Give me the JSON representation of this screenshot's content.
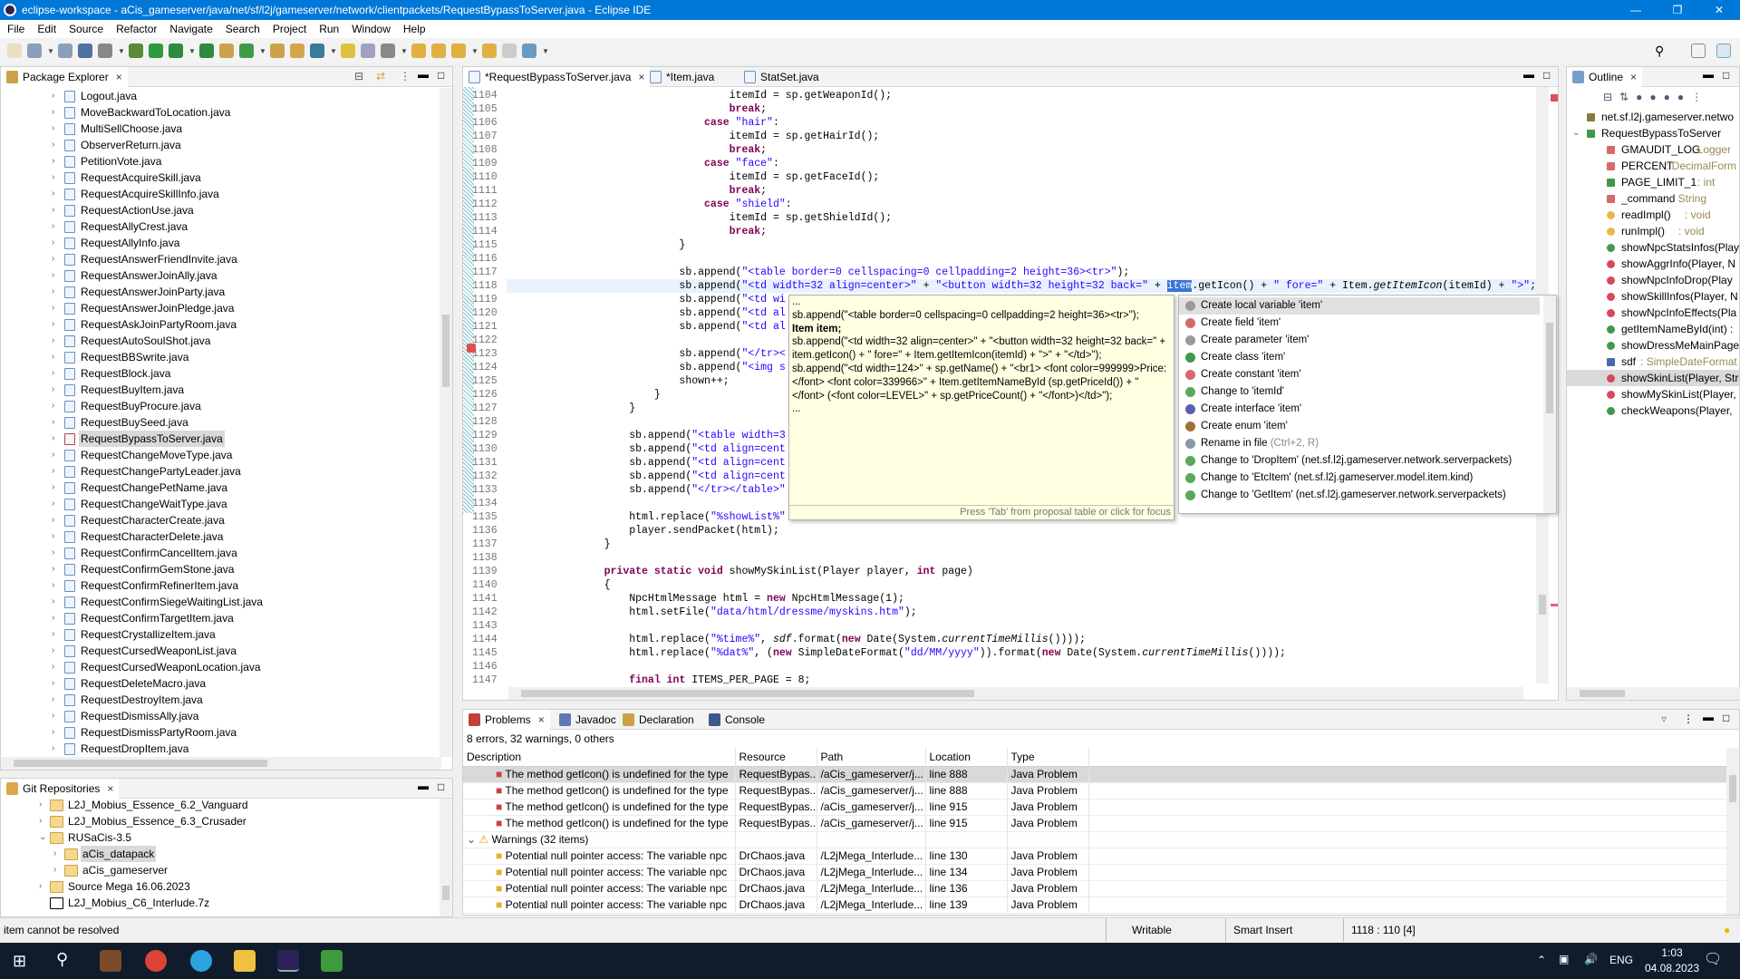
{
  "window": {
    "title": "eclipse-workspace - aCis_gameserver/java/net/sf/l2j/gameserver/network/clientpackets/RequestBypassToServer.java - Eclipse IDE"
  },
  "menu": [
    "File",
    "Edit",
    "Source",
    "Refactor",
    "Navigate",
    "Search",
    "Project",
    "Run",
    "Window",
    "Help"
  ],
  "toolbar_icons": [
    "new-icon",
    "save-icon",
    "save-all-icon",
    "terminal-icon",
    "skip-breakpoints-icon",
    "debug-icon",
    "run-icon",
    "coverage-icon",
    "external-tools-icon",
    "new-java-project-icon",
    "new-java-class-icon",
    "open-type-icon",
    "search-icon",
    "open-task-icon",
    "toggle-mark-occurrences-icon",
    "toggle-block-selection-icon",
    "show-whitespace-icon",
    "next-annotation-icon",
    "previous-annotation-icon",
    "last-edit-icon",
    "back-icon",
    "forward-icon",
    "pin-editor-icon"
  ],
  "package_explorer": {
    "title": "Package Explorer",
    "selected": "RequestBypassToServer.java",
    "items": [
      "Logout.java",
      "MoveBackwardToLocation.java",
      "MultiSellChoose.java",
      "ObserverReturn.java",
      "PetitionVote.java",
      "RequestAcquireSkill.java",
      "RequestAcquireSkillInfo.java",
      "RequestActionUse.java",
      "RequestAllyCrest.java",
      "RequestAllyInfo.java",
      "RequestAnswerFriendInvite.java",
      "RequestAnswerJoinAlly.java",
      "RequestAnswerJoinParty.java",
      "RequestAnswerJoinPledge.java",
      "RequestAskJoinPartyRoom.java",
      "RequestAutoSoulShot.java",
      "RequestBBSwrite.java",
      "RequestBlock.java",
      "RequestBuyItem.java",
      "RequestBuyProcure.java",
      "RequestBuySeed.java",
      "RequestBypassToServer.java",
      "RequestChangeMoveType.java",
      "RequestChangePartyLeader.java",
      "RequestChangePetName.java",
      "RequestChangeWaitType.java",
      "RequestCharacterCreate.java",
      "RequestCharacterDelete.java",
      "RequestConfirmCancelItem.java",
      "RequestConfirmGemStone.java",
      "RequestConfirmRefinerItem.java",
      "RequestConfirmSiegeWaitingList.java",
      "RequestConfirmTargetItem.java",
      "RequestCrystallizeItem.java",
      "RequestCursedWeaponList.java",
      "RequestCursedWeaponLocation.java",
      "RequestDeleteMacro.java",
      "RequestDestroyItem.java",
      "RequestDismissAlly.java",
      "RequestDismissPartyRoom.java",
      "RequestDropItem.java"
    ]
  },
  "git": {
    "title": "Git Repositories",
    "items": [
      {
        "label": "L2J_Mobius_Essence_6.2_Vanguard",
        "depth": 0,
        "state": "collapsed",
        "icon": "folder-icon"
      },
      {
        "label": "L2J_Mobius_Essence_6.3_Crusader",
        "depth": 0,
        "state": "collapsed",
        "icon": "folder-icon"
      },
      {
        "label": "RUSaCis-3.5",
        "depth": 0,
        "state": "expanded",
        "icon": "folder-icon"
      },
      {
        "label": "aCis_datapack",
        "depth": 1,
        "state": "collapsed",
        "icon": "folder-icon",
        "selected": true
      },
      {
        "label": "aCis_gameserver",
        "depth": 1,
        "state": "collapsed",
        "icon": "folder-icon"
      },
      {
        "label": "Source Mega 16.06.2023",
        "depth": 0,
        "state": "collapsed",
        "icon": "folder-icon"
      },
      {
        "label": "L2J_Mobius_C6_Interlude.7z",
        "depth": 0,
        "state": "none",
        "icon": "archive-icon"
      }
    ]
  },
  "editor": {
    "tabs": [
      {
        "label": "*RequestBypassToServer.java",
        "active": true,
        "close": "×"
      },
      {
        "label": "*Item.java"
      },
      {
        "label": "StatSet.java"
      }
    ],
    "keywords": [
      "break",
      "case",
      "private",
      "static",
      "void",
      "int",
      "new",
      "final"
    ],
    "italic": [
      "getItemIcon",
      "currentTimeMillis",
      "sdf"
    ],
    "current_line": 1118,
    "selected_word": "item",
    "lines": [
      {
        "n": 1104,
        "t": "\t\t\t\t\t\titemId = sp.getWeaponId();"
      },
      {
        "n": 1105,
        "t": "\t\t\t\t\t\tbreak;"
      },
      {
        "n": 1106,
        "t": "\t\t\t\t\tcase \"hair\":"
      },
      {
        "n": 1107,
        "t": "\t\t\t\t\t\titemId = sp.getHairId();"
      },
      {
        "n": 1108,
        "t": "\t\t\t\t\t\tbreak;"
      },
      {
        "n": 1109,
        "t": "\t\t\t\t\tcase \"face\":"
      },
      {
        "n": 1110,
        "t": "\t\t\t\t\t\titemId = sp.getFaceId();"
      },
      {
        "n": 1111,
        "t": "\t\t\t\t\t\tbreak;"
      },
      {
        "n": 1112,
        "t": "\t\t\t\t\tcase \"shield\":"
      },
      {
        "n": 1113,
        "t": "\t\t\t\t\t\titemId = sp.getShieldId();"
      },
      {
        "n": 1114,
        "t": "\t\t\t\t\t\tbreak;"
      },
      {
        "n": 1115,
        "t": "\t\t\t\t}"
      },
      {
        "n": 1116,
        "t": ""
      },
      {
        "n": 1117,
        "t": "\t\t\t\tsb.append(\"<table border=0 cellspacing=0 cellpadding=2 height=36><tr>\");"
      },
      {
        "n": 1118,
        "t": "\t\t\t\tsb.append(\"<td width=32 align=center>\" + \"<button width=32 height=32 back=\" + item.getIcon() + \" fore=\" + Item.getItemIcon(itemId) + \">\";"
      },
      {
        "n": 1119,
        "t": "\t\t\t\tsb.append(\"<td wi"
      },
      {
        "n": 1120,
        "t": "\t\t\t\tsb.append(\"<td al"
      },
      {
        "n": 1121,
        "t": "\t\t\t\tsb.append(\"<td al"
      },
      {
        "n": 1122,
        "t": ""
      },
      {
        "n": 1123,
        "t": "\t\t\t\tsb.append(\"</tr><"
      },
      {
        "n": 1124,
        "t": "\t\t\t\tsb.append(\"<img s"
      },
      {
        "n": 1125,
        "t": "\t\t\t\tshown++;"
      },
      {
        "n": 1126,
        "t": "\t\t\t}"
      },
      {
        "n": 1127,
        "t": "\t\t}"
      },
      {
        "n": 1128,
        "t": ""
      },
      {
        "n": 1129,
        "t": "\t\tsb.append(\"<table width=3"
      },
      {
        "n": 1130,
        "t": "\t\tsb.append(\"<td align=cent"
      },
      {
        "n": 1131,
        "t": "\t\tsb.append(\"<td align=cent"
      },
      {
        "n": 1132,
        "t": "\t\tsb.append(\"<td align=cent"
      },
      {
        "n": 1133,
        "t": "\t\tsb.append(\"</tr></table>\""
      },
      {
        "n": 1134,
        "t": ""
      },
      {
        "n": 1135,
        "t": "\t\thtml.replace(\"%showList%\""
      },
      {
        "n": 1136,
        "t": "\t\tplayer.sendPacket(html);"
      },
      {
        "n": 1137,
        "t": "\t}"
      },
      {
        "n": 1138,
        "t": ""
      },
      {
        "n": 1139,
        "t": "\tprivate static void showMySkinList(Player player, int page)"
      },
      {
        "n": 1140,
        "t": "\t{"
      },
      {
        "n": 1141,
        "t": "\t\tNpcHtmlMessage html = new NpcHtmlMessage(1);"
      },
      {
        "n": 1142,
        "t": "\t\thtml.setFile(\"data/html/dressme/myskins.htm\");"
      },
      {
        "n": 1143,
        "t": ""
      },
      {
        "n": 1144,
        "t": "\t\thtml.replace(\"%time%\", sdf.format(new Date(System.currentTimeMillis())));"
      },
      {
        "n": 1145,
        "t": "\t\thtml.replace(\"%dat%\", (new SimpleDateFormat(\"dd/MM/yyyy\")).format(new Date(System.currentTimeMillis())));"
      },
      {
        "n": 1146,
        "t": ""
      },
      {
        "n": 1147,
        "t": "\t\tfinal int ITEMS_PER_PAGE = 8;"
      }
    ]
  },
  "hover": {
    "lines": [
      {
        "t": "..."
      },
      {
        "t": "sb.append(\"<table border=0 cellspacing=0 cellpadding=2 height=36><tr>\");"
      },
      {
        "t": "Item item;",
        "bold": true
      },
      {
        "t": "sb.append(\"<td width=32 align=center>\" + \"<button width=32 height=32 back=\" + item.getIcon() + \" fore=\" + Item.getItemIcon(itemId) + \">\" + \"</td>\");"
      },
      {
        "t": "sb.append(\"<td width=124>\" + sp.getName() + \"<br1> <font color=999999>Price:</font> <font color=339966>\" + Item.getItemNameById (sp.getPriceId()) + \"</font> (<font color=LEVEL>\" + sp.getPriceCount() + \"</font>)</td>\");"
      },
      {
        "t": "..."
      }
    ],
    "footer": "Press 'Tab' from proposal table or click for focus"
  },
  "completion": {
    "items": [
      {
        "label": "Create local variable 'item'",
        "icon": "local-variable-icon",
        "color": "#9a9a9a",
        "selected": true
      },
      {
        "label": "Create field 'item'",
        "icon": "field-icon",
        "color": "#d46a6a"
      },
      {
        "label": "Create parameter 'item'",
        "icon": "parameter-icon",
        "color": "#9a9a9a"
      },
      {
        "label": "Create class 'item'",
        "icon": "class-icon",
        "color": "#3f9a4a"
      },
      {
        "label": "Create constant 'item'",
        "icon": "constant-icon",
        "color": "#d46a6a"
      },
      {
        "label": "Change to 'itemId'",
        "icon": "change-icon",
        "color": "#5aa85a"
      },
      {
        "label": "Create interface 'item'",
        "icon": "interface-icon",
        "color": "#5b5fb0"
      },
      {
        "label": "Create enum 'item'",
        "icon": "enum-icon",
        "color": "#a0703a"
      },
      {
        "label": "Rename in file",
        "sub": " (Ctrl+2, R)",
        "icon": "rename-icon",
        "color": "#8899aa"
      },
      {
        "label": "Change to 'DropItem' (net.sf.l2j.gameserver.network.serverpackets)",
        "icon": "change-icon",
        "color": "#5aa85a"
      },
      {
        "label": "Change to 'EtcItem' (net.sf.l2j.gameserver.model.item.kind)",
        "icon": "change-icon",
        "color": "#5aa85a"
      },
      {
        "label": "Change to 'GetItem' (net.sf.l2j.gameserver.network.serverpackets)",
        "icon": "change-icon",
        "color": "#5aa85a"
      }
    ]
  },
  "outline": {
    "title": "Outline",
    "items": [
      {
        "name": "net.sf.l2j.gameserver.netwo",
        "type": "",
        "icon": "package-icon",
        "color": "#8a7a3a",
        "depth": 0
      },
      {
        "name": "RequestBypassToServer",
        "type": "",
        "icon": "class-error-icon",
        "color": "#3f9a4a",
        "depth": 0,
        "expanded": true
      },
      {
        "name": "GMAUDIT_LOG",
        "type": " : Logger",
        "icon": "private-static-final-field-icon",
        "color": "#d46a6a",
        "depth": 1
      },
      {
        "name": "PERCENT",
        "type": " : DecimalForm",
        "icon": "private-static-final-field-icon",
        "color": "#d46a6a",
        "depth": 1
      },
      {
        "name": "PAGE_LIMIT_1",
        "type": " : int",
        "icon": "public-static-final-field-icon",
        "color": "#3f9a4a",
        "depth": 1
      },
      {
        "name": "_command",
        "type": " : String",
        "icon": "private-field-icon",
        "color": "#d46a6a",
        "depth": 1
      },
      {
        "name": "readImpl()",
        "type": " : void",
        "icon": "protected-method-icon",
        "color": "#e8b84a",
        "depth": 1
      },
      {
        "name": "runImpl()",
        "type": " : void",
        "icon": "protected-method-icon",
        "color": "#e8b84a",
        "depth": 1
      },
      {
        "name": "showNpcStatsInfos(Play",
        "type": "",
        "icon": "public-static-method-icon",
        "color": "#3f9a4a",
        "depth": 1
      },
      {
        "name": "showAggrInfo(Player, N",
        "type": "",
        "icon": "private-static-method-icon",
        "color": "#d44a5a",
        "depth": 1
      },
      {
        "name": "showNpcInfoDrop(Play",
        "type": "",
        "icon": "private-static-method-error-icon",
        "color": "#d44a5a",
        "depth": 1
      },
      {
        "name": "showSkillInfos(Player, N",
        "type": "",
        "icon": "private-static-method-icon",
        "color": "#d44a5a",
        "depth": 1
      },
      {
        "name": "showNpcInfoEffects(Pla",
        "type": "",
        "icon": "private-static-method-icon",
        "color": "#d44a5a",
        "depth": 1
      },
      {
        "name": "getItemNameById(int) :",
        "type": "",
        "icon": "public-static-method-icon",
        "color": "#3f9a4a",
        "depth": 1
      },
      {
        "name": "showDressMeMainPage",
        "type": "",
        "icon": "public-static-method-icon",
        "color": "#3f9a4a",
        "depth": 1
      },
      {
        "name": "sdf",
        "type": " : SimpleDateFormat",
        "icon": "default-static-field-icon",
        "color": "#4a6ab0",
        "depth": 1
      },
      {
        "name": "showSkinList(Player, Str",
        "type": "",
        "icon": "private-static-method-icon",
        "color": "#d44a5a",
        "depth": 1,
        "selected": true
      },
      {
        "name": "showMySkinList(Player,",
        "type": "",
        "icon": "private-static-method-icon",
        "color": "#d44a5a",
        "depth": 1
      },
      {
        "name": "checkWeapons(Player,",
        "type": "",
        "icon": "public-static-method-icon",
        "color": "#3f9a4a",
        "depth": 1
      }
    ]
  },
  "problems": {
    "tabs": [
      "Problems",
      "Javadoc",
      "Declaration",
      "Console"
    ],
    "summary": "8 errors, 32 warnings, 0 others",
    "columns": [
      "Description",
      "Resource",
      "Path",
      "Location",
      "Type"
    ],
    "rows": [
      {
        "kind": "error",
        "cells": [
          "The method getIcon() is undefined for the type",
          "RequestBypas...",
          "/aCis_gameserver/j...",
          "line 888",
          "Java Problem"
        ],
        "selected": true
      },
      {
        "kind": "error",
        "cells": [
          "The method getIcon() is undefined for the type",
          "RequestBypas...",
          "/aCis_gameserver/j...",
          "line 888",
          "Java Problem"
        ]
      },
      {
        "kind": "error",
        "cells": [
          "The method getIcon() is undefined for the type",
          "RequestBypas...",
          "/aCis_gameserver/j...",
          "line 915",
          "Java Problem"
        ]
      },
      {
        "kind": "error",
        "cells": [
          "The method getIcon() is undefined for the type",
          "RequestBypas...",
          "/aCis_gameserver/j...",
          "line 915",
          "Java Problem"
        ]
      },
      {
        "kind": "group",
        "cells": [
          "Warnings (32 items)",
          "",
          "",
          "",
          ""
        ]
      },
      {
        "kind": "warning",
        "cells": [
          "Potential null pointer access: The variable npc",
          "DrChaos.java",
          "/L2jMega_Interlude...",
          "line 130",
          "Java Problem"
        ]
      },
      {
        "kind": "warning",
        "cells": [
          "Potential null pointer access: The variable npc",
          "DrChaos.java",
          "/L2jMega_Interlude...",
          "line 134",
          "Java Problem"
        ]
      },
      {
        "kind": "warning",
        "cells": [
          "Potential null pointer access: The variable npc",
          "DrChaos.java",
          "/L2jMega_Interlude...",
          "line 136",
          "Java Problem"
        ]
      },
      {
        "kind": "warning",
        "cells": [
          "Potential null pointer access: The variable npc",
          "DrChaos.java",
          "/L2jMega_Interlude...",
          "line 139",
          "Java Problem"
        ]
      }
    ]
  },
  "status": {
    "message": "item cannot be resolved",
    "writable": "Writable",
    "insert_mode": "Smart Insert",
    "position": "1118 : 110 [4]"
  },
  "taskbar": {
    "lang": "ENG",
    "time": "1:03",
    "date": "04.08.2023"
  }
}
